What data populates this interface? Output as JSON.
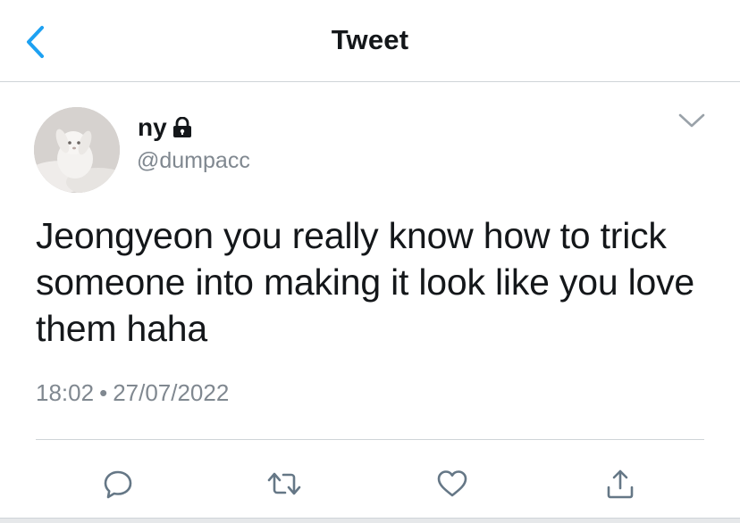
{
  "header": {
    "title": "Tweet",
    "back_icon": "chevron-left-icon"
  },
  "tweet": {
    "author": {
      "display_name": "ny",
      "handle": "@dumpacc",
      "protected_icon": "lock-icon"
    },
    "text": "Jeongyeon you really know how to trick someone into making it look like you love them haha",
    "time": "18:02",
    "separator": "•",
    "date": "27/07/2022",
    "menu_icon": "chevron-down-icon"
  },
  "actions": {
    "reply_icon": "reply-icon",
    "retweet_icon": "retweet-icon",
    "like_icon": "heart-icon",
    "share_icon": "share-icon"
  },
  "colors": {
    "accent": "#1da1f2",
    "text": "#14171a",
    "secondary": "#808890",
    "divider": "#cfd4d8"
  }
}
